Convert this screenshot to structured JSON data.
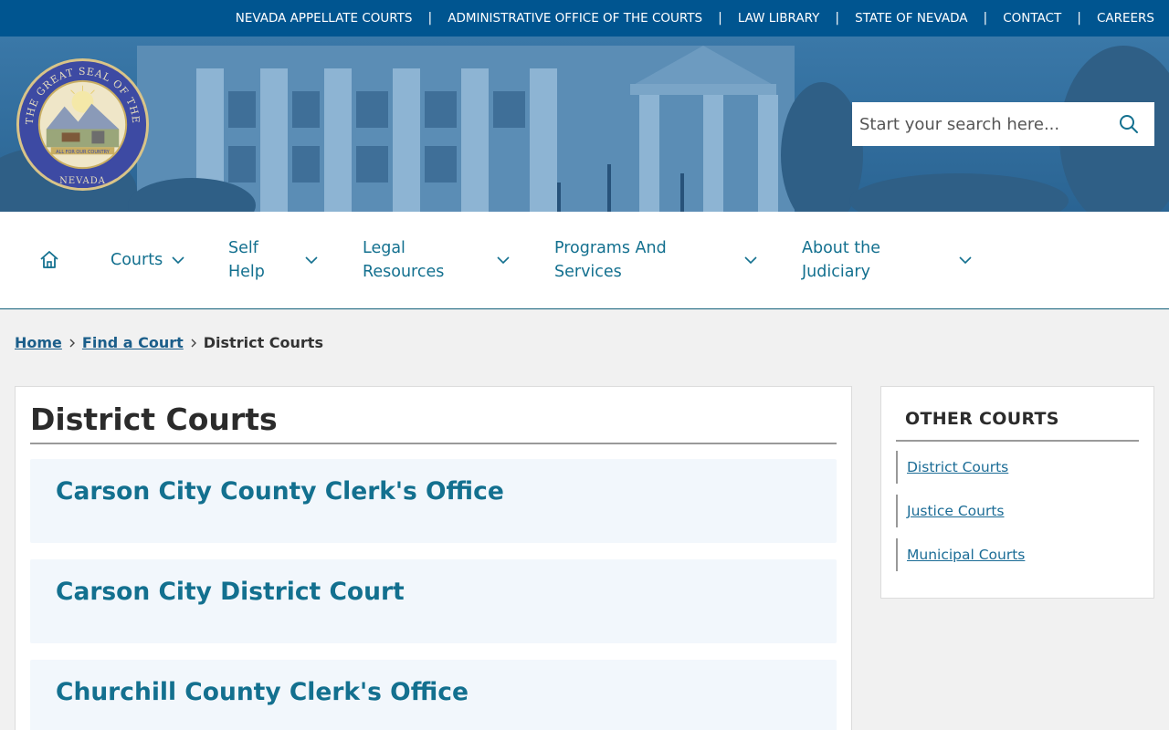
{
  "topbar": {
    "links": [
      "NEVADA APPELLATE COURTS",
      "ADMINISTRATIVE OFFICE OF THE COURTS",
      "LAW LIBRARY",
      "STATE OF NEVADA",
      "CONTACT",
      "CAREERS"
    ],
    "separator": "|"
  },
  "header": {
    "seal": {
      "outer_text": "THE GREAT SEAL OF THE STATE OF",
      "bottom_text": "NEVADA",
      "motto": "ALL FOR OUR COUNTRY"
    },
    "search": {
      "placeholder": "Start your search here..."
    }
  },
  "nav": {
    "items": [
      {
        "label": "Courts"
      },
      {
        "label": "Self Help",
        "line1": "Self",
        "line2": "Help"
      },
      {
        "label": "Legal Resources",
        "line1": "Legal",
        "line2": "Resources"
      },
      {
        "label": "Programs And Services",
        "line1": "Programs And",
        "line2": "Services"
      },
      {
        "label": "About the Judiciary",
        "line1": "About the",
        "line2": "Judiciary"
      }
    ]
  },
  "breadcrumb": {
    "home": "Home",
    "find_court": "Find a Court",
    "current": "District Courts"
  },
  "main": {
    "title": "District Courts",
    "courts": [
      "Carson City County Clerk's Office",
      "Carson City District Court",
      "Churchill County Clerk's Office"
    ]
  },
  "sidebar": {
    "title": "OTHER COURTS",
    "links": [
      "District Courts",
      "Justice Courts",
      "Municipal Courts"
    ]
  },
  "colors": {
    "topbar": "#005590",
    "link": "#13708f",
    "hero_tint": "#2b6a9b"
  }
}
